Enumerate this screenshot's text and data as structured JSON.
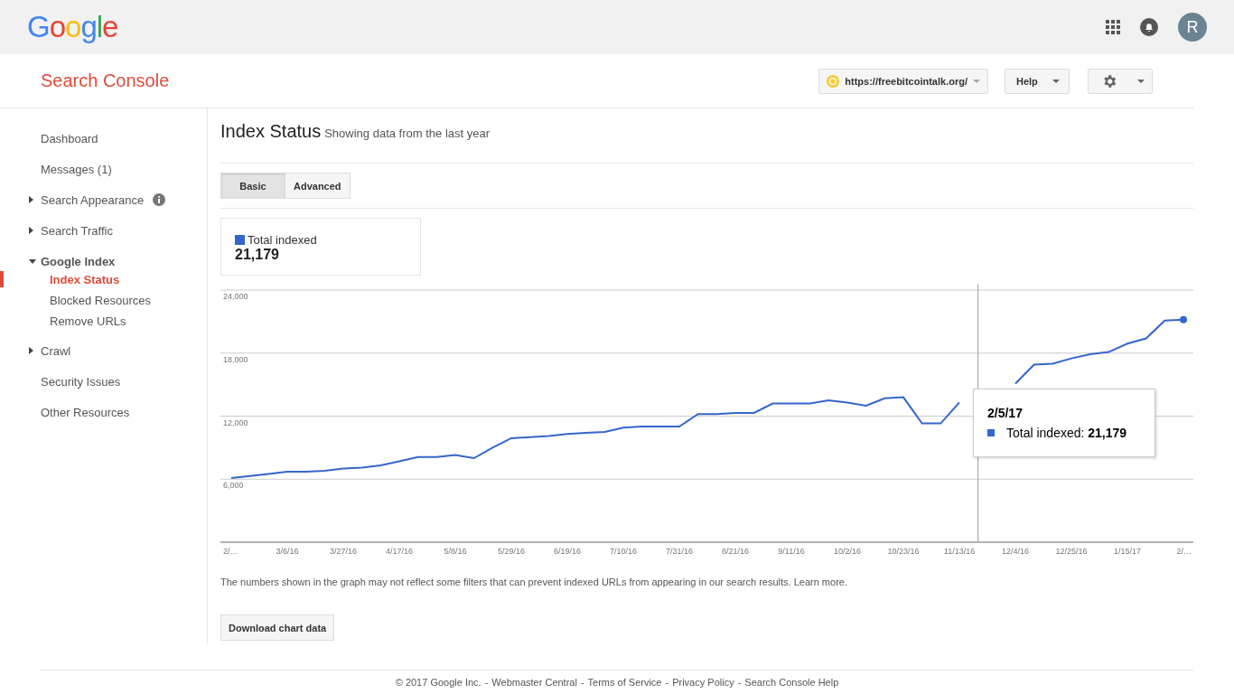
{
  "topbar": {
    "logo": "Google",
    "avatar": "R"
  },
  "header": {
    "title": "Search Console",
    "site": "https://freebitcointalk.org/",
    "help": "Help"
  },
  "sidebar": {
    "items": [
      {
        "kind": "link",
        "label": "Dashboard",
        "selected": false
      },
      {
        "kind": "link",
        "label": "Messages (1)",
        "selected": false
      },
      {
        "kind": "section",
        "label": "Search Appearance",
        "expanded": false,
        "info": true,
        "selected": false
      },
      {
        "kind": "section",
        "label": "Search Traffic",
        "expanded": false,
        "info": false,
        "selected": false
      },
      {
        "kind": "section",
        "label": "Google Index",
        "expanded": true,
        "info": false,
        "selected": false,
        "children": [
          {
            "label": "Index Status",
            "selected": true
          },
          {
            "label": "Blocked Resources",
            "selected": false
          },
          {
            "label": "Remove URLs",
            "selected": false
          }
        ]
      },
      {
        "kind": "section",
        "label": "Crawl",
        "expanded": false,
        "info": false,
        "selected": false
      },
      {
        "kind": "link",
        "label": "Security Issues",
        "selected": false
      },
      {
        "kind": "link",
        "label": "Other Resources",
        "selected": false
      }
    ]
  },
  "page": {
    "title": "Index Status",
    "subtitle": "Showing data from the last year",
    "tabs": [
      {
        "label": "Basic",
        "selected": true
      },
      {
        "label": "Advanced",
        "selected": false
      }
    ],
    "legend": {
      "value": "21,179",
      "color": "#3366cc"
    },
    "chart_data": {
      "type": "line",
      "categories": [
        "2/…",
        null,
        null,
        "3/6/16",
        null,
        null,
        "3/27/16",
        null,
        null,
        "4/17/16",
        null,
        null,
        "5/8/16",
        null,
        null,
        "5/29/16",
        null,
        null,
        "6/19/16",
        null,
        null,
        "7/10/16",
        null,
        null,
        "7/31/16",
        null,
        null,
        "8/21/16",
        null,
        null,
        "9/11/16",
        null,
        null,
        "10/2/16",
        null,
        null,
        "10/23/16",
        null,
        null,
        "11/13/16",
        null,
        null,
        "12/4/16",
        null,
        null,
        "12/25/16",
        null,
        null,
        "1/15/17",
        null,
        null,
        "2/…"
      ],
      "series": [
        {
          "name": "Total indexed",
          "color": "#3366cc",
          "values": [
            6100,
            6300,
            6500,
            6700,
            6700,
            6800,
            7000,
            7100,
            7300,
            7700,
            8100,
            8100,
            8300,
            8000,
            9000,
            9900,
            10000,
            10100,
            10300,
            10400,
            10500,
            10900,
            11000,
            11000,
            11000,
            12200,
            12200,
            12300,
            12300,
            13200,
            13200,
            13200,
            13500,
            13300,
            13000,
            13700,
            13800,
            11300,
            11300,
            13300,
            null,
            null,
            15100,
            16900,
            17000,
            17500,
            17900,
            18100,
            18900,
            19400,
            21100,
            21179
          ]
        }
      ],
      "ylim": [
        0,
        24000
      ],
      "yticks": [
        {
          "value": 6000,
          "label": "6,000"
        },
        {
          "value": 12000,
          "label": "12,000"
        },
        {
          "value": 18000,
          "label": "18,000"
        },
        {
          "value": 24000,
          "label": "24,000"
        }
      ],
      "grid": true
    },
    "tooltip": {
      "title": "2/5/17",
      "text": "Total indexed: **21,179**",
      "color": "#3366cc"
    },
    "note": "The numbers shown in the graph may not reflect some filters that can prevent indexed URLs from appearing in our search results.",
    "note_link": "Learn more.",
    "download": "Download chart data"
  },
  "footer": {
    "separator": "-",
    "items": [
      "© 2017 Google Inc.",
      "Webmaster Central",
      "Terms of Service",
      "Privacy Policy",
      "Search Console Help"
    ]
  }
}
